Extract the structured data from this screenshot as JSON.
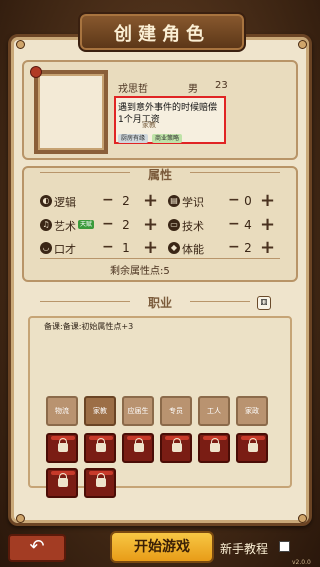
{
  "screen_title": "创建角色",
  "character": {
    "name": "戎思哲",
    "gender": "男",
    "age": "23",
    "traits": [
      "遇到意外事件的时候赔偿",
      "1个月工资",
      "家教"
    ],
    "tags": [
      "厨房有缘",
      "商业策略"
    ]
  },
  "attributes_section": {
    "title": "属性",
    "stats": [
      {
        "label": "逻辑",
        "value": "2",
        "icon": "logic-icon"
      },
      {
        "label": "学识",
        "value": "0",
        "icon": "book-icon"
      },
      {
        "label": "艺术",
        "value": "2",
        "icon": "music-icon",
        "badge": "天赋"
      },
      {
        "label": "技术",
        "value": "4",
        "icon": "computer-icon"
      },
      {
        "label": "口才",
        "value": "1",
        "icon": "mouth-icon"
      },
      {
        "label": "体能",
        "value": "2",
        "icon": "fitness-icon"
      }
    ],
    "remaining": "剩余属性点:5"
  },
  "career_section": {
    "title": "职业",
    "description": "备课:备课:初始属性点+3",
    "jobs": [
      "物流",
      "家教",
      "应届生",
      "专员",
      "工人",
      "家政"
    ],
    "selected_job": "家教",
    "locked_count": 8
  },
  "footer": {
    "back_icon": "back-arrow-icon",
    "start_label": "开始游戏",
    "tutorial_label": "新手教程",
    "version": "v2.0.0"
  },
  "colors": {
    "accent": "#f0b030",
    "highlight": "#e02424",
    "wood": "#6b4424"
  }
}
